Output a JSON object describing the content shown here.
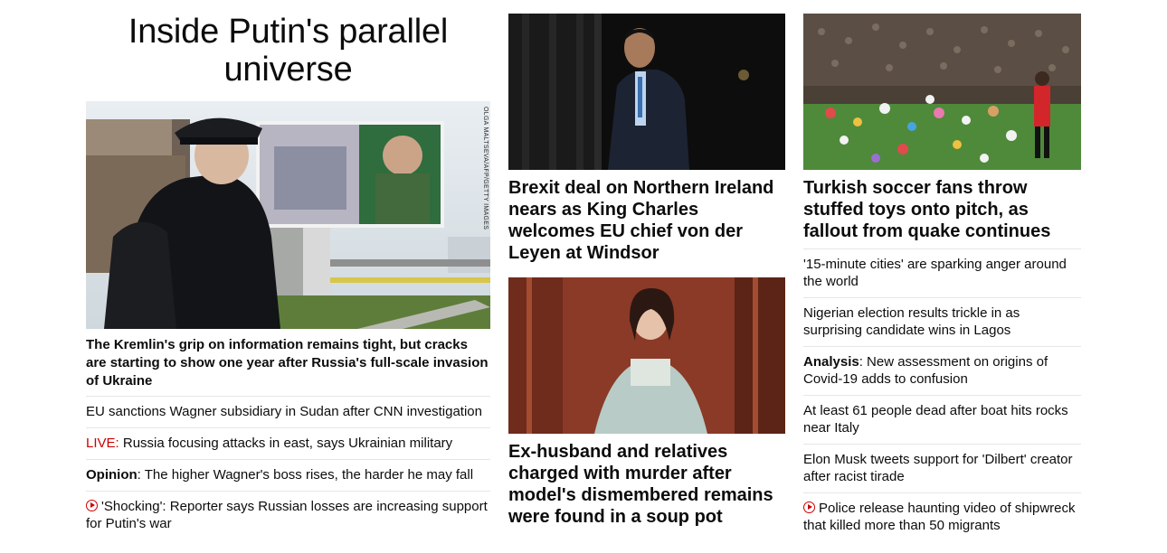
{
  "col1": {
    "headline": "Inside Putin's parallel universe",
    "image": {
      "alt": "Soldier walking past billboard",
      "credit": "OLGA MALTSEVA/AFP/GETTY IMAGES"
    },
    "lead": "The Kremlin's grip on information remains tight, but cracks are starting to show one year after Russia's full-scale invasion of Ukraine",
    "bullets": [
      {
        "text": "EU sanctions Wagner subsidiary in Sudan after CNN investigation"
      },
      {
        "prefix": "LIVE:",
        "text": " Russia focusing attacks in east, says Ukrainian military"
      },
      {
        "prefix": "Opinion",
        "text": ": The higher Wagner's boss rises, the harder he may fall"
      },
      {
        "icon": "play-icon",
        "text": "'Shocking': Reporter says Russian losses are increasing support for Putin's war"
      }
    ]
  },
  "col2": {
    "card1": {
      "title": "Brexit deal on Northern Ireland nears as King Charles welcomes EU chief von der Leyen at Windsor",
      "image_alt": "Man in suit at dark doorway"
    },
    "card2": {
      "title": "Ex-husband and relatives charged with murder after model's dismembered remains were found in a soup pot",
      "image_alt": "Model in pale gown"
    }
  },
  "col3": {
    "card1": {
      "title": "Turkish soccer fans throw stuffed toys onto pitch, as fallout from quake continues",
      "image_alt": "Stuffed toys on soccer pitch"
    },
    "bullets": [
      {
        "text": "'15-minute cities' are sparking anger around the world"
      },
      {
        "text": "Nigerian election results trickle in as surprising candidate wins in Lagos"
      },
      {
        "prefix": "Analysis",
        "text": ": New assessment on origins of Covid-19 adds to confusion"
      },
      {
        "text": "At least 61 people dead after boat hits rocks near Italy"
      },
      {
        "text": "Elon Musk tweets support for 'Dilbert' creator after racist tirade"
      },
      {
        "icon": "play-icon",
        "text": "Police release haunting video of shipwreck that killed more than 50 migrants"
      }
    ]
  },
  "colors": {
    "live_red": "#cc0000",
    "divider": "#e6e6e6",
    "text": "#0c0c0c"
  }
}
